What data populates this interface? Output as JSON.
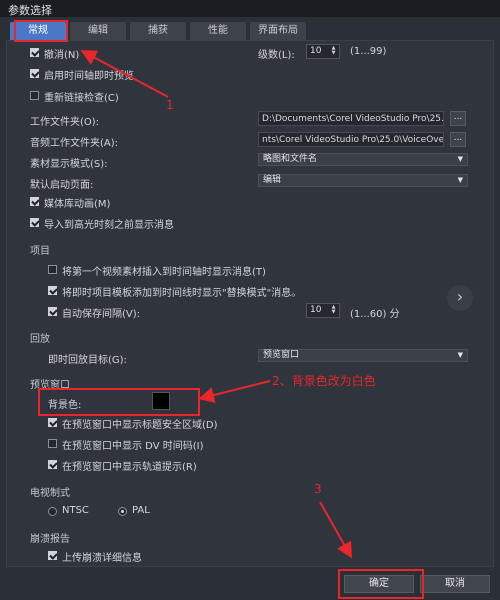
{
  "window": {
    "title": "参数选择"
  },
  "tabs": [
    "常规",
    "编辑",
    "捕获",
    "性能",
    "界面布局"
  ],
  "general": {
    "undo": {
      "label": "撤消(N)",
      "checked": true
    },
    "levels": {
      "label": "级数(L):",
      "value": "10",
      "range": "(1...99)"
    },
    "timeline_preview": {
      "label": "启用时间轴即时预览",
      "checked": true
    },
    "relink": {
      "label": "重新链接检查(C)",
      "checked": false
    },
    "work_folder": {
      "label": "工作文件夹(O):",
      "value": "D:\\Documents\\Corel VideoStudio Pro\\25.0\\",
      "button": "..."
    },
    "audio_folder": {
      "label": "音频工作文件夹(A):",
      "value": "nts\\Corel VideoStudio Pro\\25.0\\VoiceOver\\",
      "button": "..."
    },
    "clip_display": {
      "label": "素材显示模式(S):",
      "value": "略图和文件名"
    },
    "default_page": {
      "label": "默认启动页面:",
      "value": "编辑"
    },
    "media_anim": {
      "label": "媒体库动画(M)",
      "checked": true
    },
    "import_highlight": {
      "label": "导入到高光时刻之前显示消息",
      "checked": true
    }
  },
  "project": {
    "heading": "项目",
    "insert_first": {
      "label": "将第一个视频素材插入到时间轴时显示消息(T)",
      "checked": false
    },
    "replace_mode": {
      "label": "将即时项目模板添加到时间线时显示\"替换模式\"消息。",
      "checked": true
    },
    "autosave": {
      "label": "自动保存间隔(V):",
      "checked": true,
      "value": "10",
      "range": "(1...60) 分"
    },
    "next_icon": "chevron-right-icon"
  },
  "playback": {
    "heading": "回放",
    "target": {
      "label": "即时回放目标(G):",
      "value": "预览窗口"
    }
  },
  "preview": {
    "heading": "预览窗口",
    "bg_color": {
      "label": "背景色:",
      "color": "#000000"
    },
    "safe_area": {
      "label": "在预览窗口中显示标题安全区域(D)",
      "checked": true
    },
    "dv_timecode": {
      "label": "在预览窗口中显示 DV 时间码(I)",
      "checked": false
    },
    "track_hints": {
      "label": "在预览窗口中显示轨道提示(R)",
      "checked": true
    }
  },
  "tv_system": {
    "heading": "电视制式",
    "ntsc": {
      "label": "NTSC",
      "selected": false
    },
    "pal": {
      "label": "PAL",
      "selected": true
    }
  },
  "crash": {
    "heading": "崩溃报告",
    "upload": {
      "label": "上传崩溃详细信息",
      "checked": true
    }
  },
  "buttons": {
    "ok": "确定",
    "cancel": "取消"
  },
  "annotations": {
    "a1": "1",
    "a2": "2、背景色改为白色",
    "a3": "3",
    "color": "#e8262b"
  }
}
